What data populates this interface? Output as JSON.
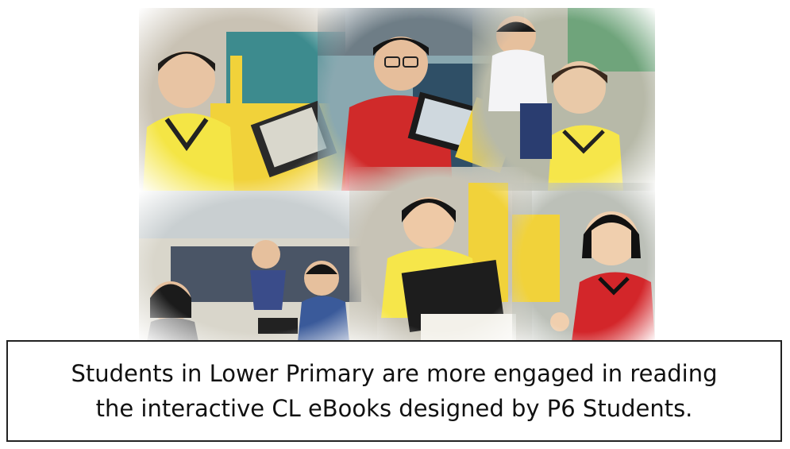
{
  "caption": {
    "line1": "Students in Lower Primary are more engaged in reading",
    "line2": "the interactive CL eBooks designed by P6 Students."
  },
  "photos": [
    {
      "name": "photo-top-left-boy-yellow-shirt-tablet"
    },
    {
      "name": "photo-top-middle-boy-red-shirt-tablet"
    },
    {
      "name": "photo-top-right-two-boys"
    },
    {
      "name": "photo-bottom-left-classroom"
    },
    {
      "name": "photo-bottom-middle-girl-yellow-shirt"
    },
    {
      "name": "photo-bottom-right-girl-red-shirt"
    }
  ]
}
